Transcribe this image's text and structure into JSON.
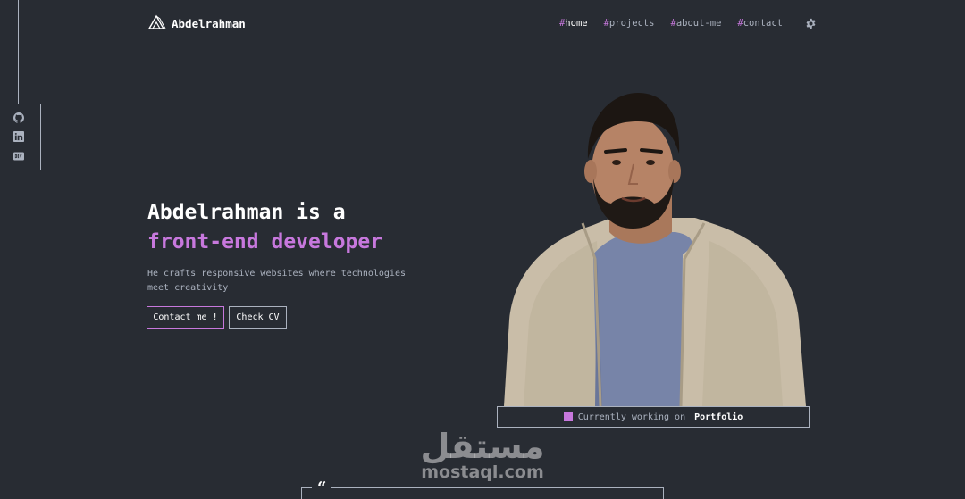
{
  "header": {
    "logo_text": "Abdelrahman",
    "nav": [
      {
        "hash": "#",
        "label": "home"
      },
      {
        "hash": "#",
        "label": "projects"
      },
      {
        "hash": "#",
        "label": "about-me"
      },
      {
        "hash": "#",
        "label": "contact"
      }
    ],
    "settings_icon": "gear-icon"
  },
  "social": {
    "icons": [
      "github-icon",
      "linkedin-icon",
      "dev-icon"
    ]
  },
  "hero": {
    "title_line1": "Abdelrahman is a",
    "title_line2": "front-end developer",
    "description": "He crafts responsive websites where technologies meet creativity",
    "contact_button": "Contact me !",
    "cv_button": "Check CV"
  },
  "status": {
    "label": "Currently working on",
    "project": "Portfolio"
  },
  "watermark": {
    "arabic": "مستقل",
    "latin": "mostaql.com"
  },
  "quote": {
    "mark": "“"
  },
  "colors": {
    "background": "#282c33",
    "accent": "#c778dd",
    "text": "#abb2bf",
    "white": "#ffffff"
  }
}
